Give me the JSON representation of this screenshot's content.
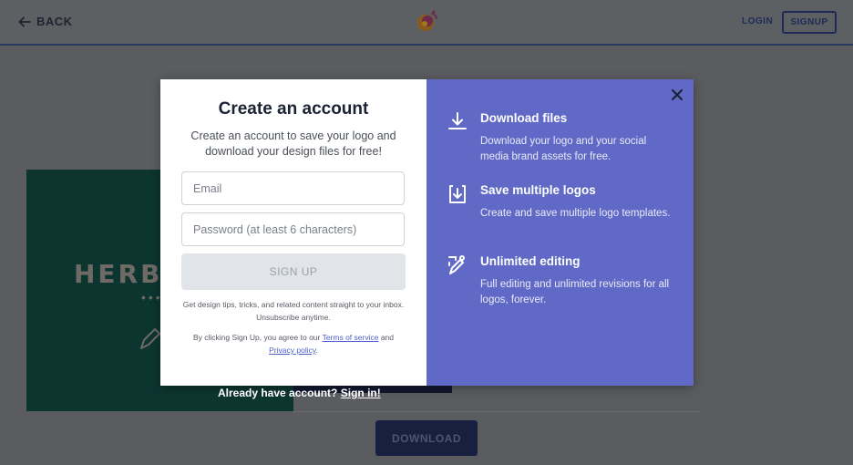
{
  "header": {
    "back_label": "BACK",
    "login_label": "LOGIN",
    "signup_label": "SIGNUP"
  },
  "background": {
    "preview_text": "HERBA",
    "download_label": "DOWNLOAD"
  },
  "modal": {
    "title": "Create an account",
    "subtitle": "Create an account to save your logo and download your design files for free!",
    "email_placeholder": "Email",
    "password_placeholder": "Password (at least 6 characters)",
    "submit_label": "SIGN UP",
    "newsletter_note": "Get design tips, tricks, and related content straight to your inbox. Unsubscribe anytime.",
    "terms_prefix": "By clicking Sign Up, you agree to our ",
    "terms_link": "Terms of service",
    "terms_and": " and",
    "privacy_link": "Privacy policy",
    "terms_suffix": "."
  },
  "features": [
    {
      "icon": "download-icon",
      "title": "Download files",
      "desc": "Download your logo and your social media brand assets for free."
    },
    {
      "icon": "save-icon",
      "title": "Save multiple logos",
      "desc": "Create and save multiple logo templates."
    },
    {
      "icon": "edit-icon",
      "title": "Unlimited editing",
      "desc": "Full editing and unlimited revisions for all logos, forever."
    }
  ],
  "footer": {
    "already_text": "Already have account?",
    "signin_link": "Sign in!"
  },
  "colors": {
    "accent_panel": "#6069c5",
    "overlay": "#5a5c5f",
    "link": "#4d60c9"
  }
}
